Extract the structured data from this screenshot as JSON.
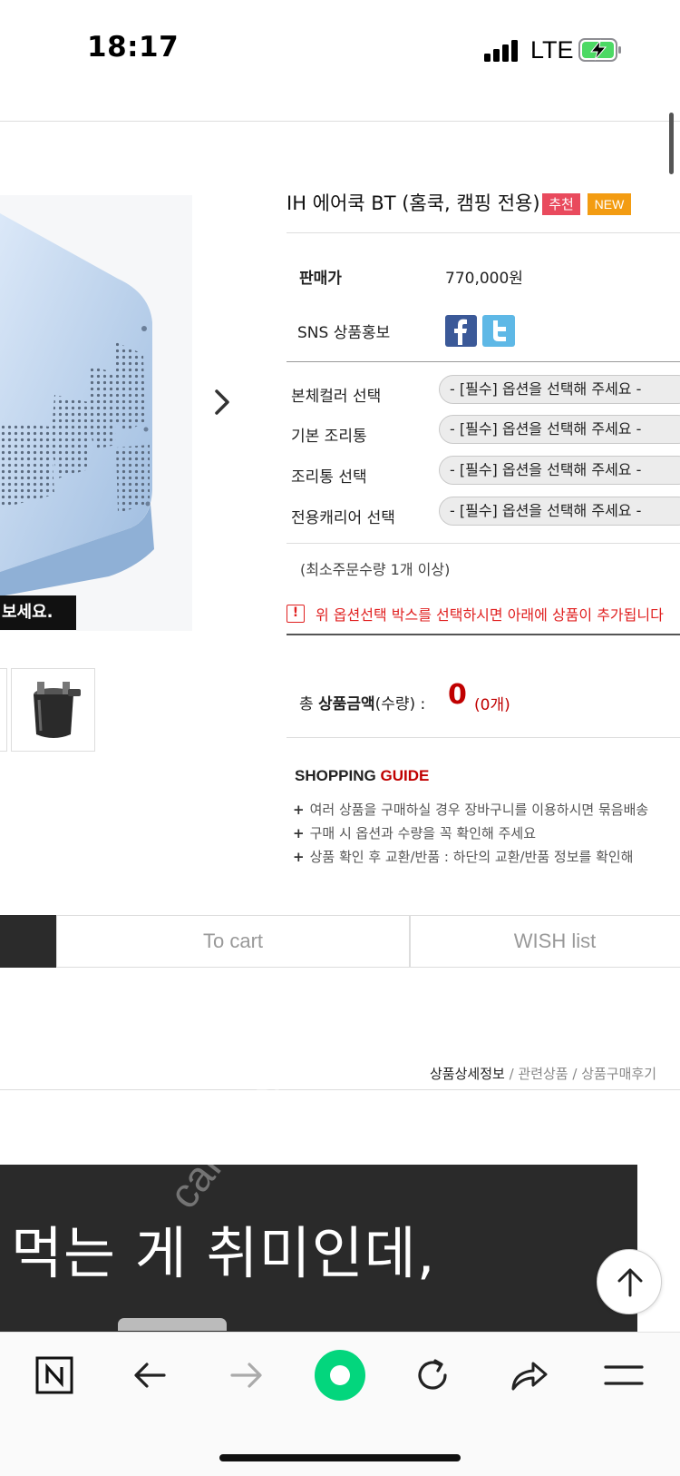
{
  "status_bar": {
    "time": "18:17",
    "network": "LTE"
  },
  "gallery": {
    "caption": "보세요."
  },
  "product": {
    "title": "IH 에어쿡 BT (홈쿡, 캠핑 전용)",
    "badges": {
      "recommend": "추천",
      "new": "NEW"
    },
    "price_label": "판매가",
    "price": "770,000원",
    "sns_label": "SNS 상품홍보"
  },
  "options": [
    {
      "label": "본체컬러 선택",
      "placeholder": "- [필수] 옵션을 선택해 주세요 -"
    },
    {
      "label": "기본 조리통",
      "placeholder": "- [필수] 옵션을 선택해 주세요 -"
    },
    {
      "label": "조리통 선택",
      "placeholder": "- [필수] 옵션을 선택해 주세요 -"
    },
    {
      "label": "전용캐리어 선택",
      "placeholder": "- [필수] 옵션을 선택해 주세요 -"
    }
  ],
  "min_order": "(최소주문수량 1개 이상)",
  "notice": "위 옵션선택 박스를 선택하시면 아래에 상품이 추가됩니다",
  "total": {
    "label_prefix": "총 ",
    "label_bold": "상품금액",
    "label_suffix": "(수량) :",
    "amount": "0",
    "count": "(0개)"
  },
  "guide": {
    "title_black": "SHOPPING ",
    "title_red": "GUIDE",
    "items": [
      "여러 상품을 구매하실 경우 장바구니를 이용하시면 묶음배송",
      "구매 시 옵션과 수량을 꼭 확인해 주세요",
      "상품 확인 후 교환/반품 : 하단의 교환/반품 정보를 확인해"
    ]
  },
  "buttons": {
    "cart": "To cart",
    "wish": "WISH list"
  },
  "tabs": {
    "detail": "상품상세정보",
    "related": "관련상품",
    "review": "상품구매후기",
    "sep": " / "
  },
  "banner": {
    "text": "먹는 게 취미인데,",
    "watermark": "cafe.naver.com"
  }
}
